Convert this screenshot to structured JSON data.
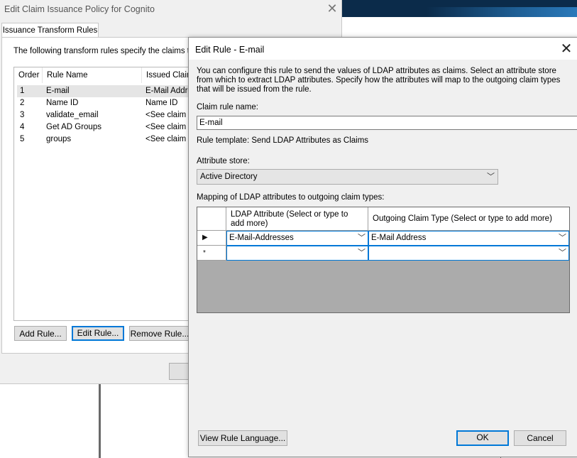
{
  "background_dialog": {
    "title": "Edit Claim Issuance Policy for Cognito",
    "tab_label": "Issuance Transform Rules",
    "description": "The following transform rules specify the claims that w",
    "columns": [
      "Order",
      "Rule Name",
      "Issued Claims"
    ],
    "rules": [
      {
        "order": "1",
        "name": "E-mail",
        "issued": "E-Mail Addre"
      },
      {
        "order": "2",
        "name": "Name ID",
        "issued": "Name ID"
      },
      {
        "order": "3",
        "name": "validate_email",
        "issued": "<See claim ru"
      },
      {
        "order": "4",
        "name": "Get AD Groups",
        "issued": "<See claim ru"
      },
      {
        "order": "5",
        "name": "groups",
        "issued": "<See claim ru"
      }
    ],
    "buttons": {
      "add_rule": "Add Rule...",
      "edit_rule": "Edit Rule...",
      "remove_rule": "Remove Rule..."
    }
  },
  "edit_dialog": {
    "title": "Edit Rule - E-mail",
    "description": "You can configure this rule to send the values of LDAP attributes as claims. Select an attribute store from which to extract LDAP attributes. Specify how the attributes will map to the outgoing claim types that will be issued from the rule.",
    "claim_rule_name_label": "Claim rule name:",
    "claim_rule_name_value": "E-mail",
    "rule_template": "Rule template: Send LDAP Attributes as Claims",
    "attribute_store_label": "Attribute store:",
    "attribute_store_value": "Active Directory",
    "mapping_label": "Mapping of LDAP attributes to outgoing claim types:",
    "grid": {
      "col_ldap": "LDAP Attribute (Select or type to add more)",
      "col_claim": "Outgoing Claim Type (Select or type to add more)",
      "rows": [
        {
          "marker": "▶",
          "ldap": "E-Mail-Addresses",
          "claim": "E-Mail Address"
        },
        {
          "marker": "*",
          "ldap": "",
          "claim": ""
        }
      ]
    },
    "buttons": {
      "view_rule_language": "View Rule Language...",
      "ok": "OK",
      "cancel": "Cancel"
    }
  },
  "colors": {
    "accent": "#0078d7",
    "dialog_bg": "#f0f0f0",
    "grid_empty": "#ababab"
  }
}
